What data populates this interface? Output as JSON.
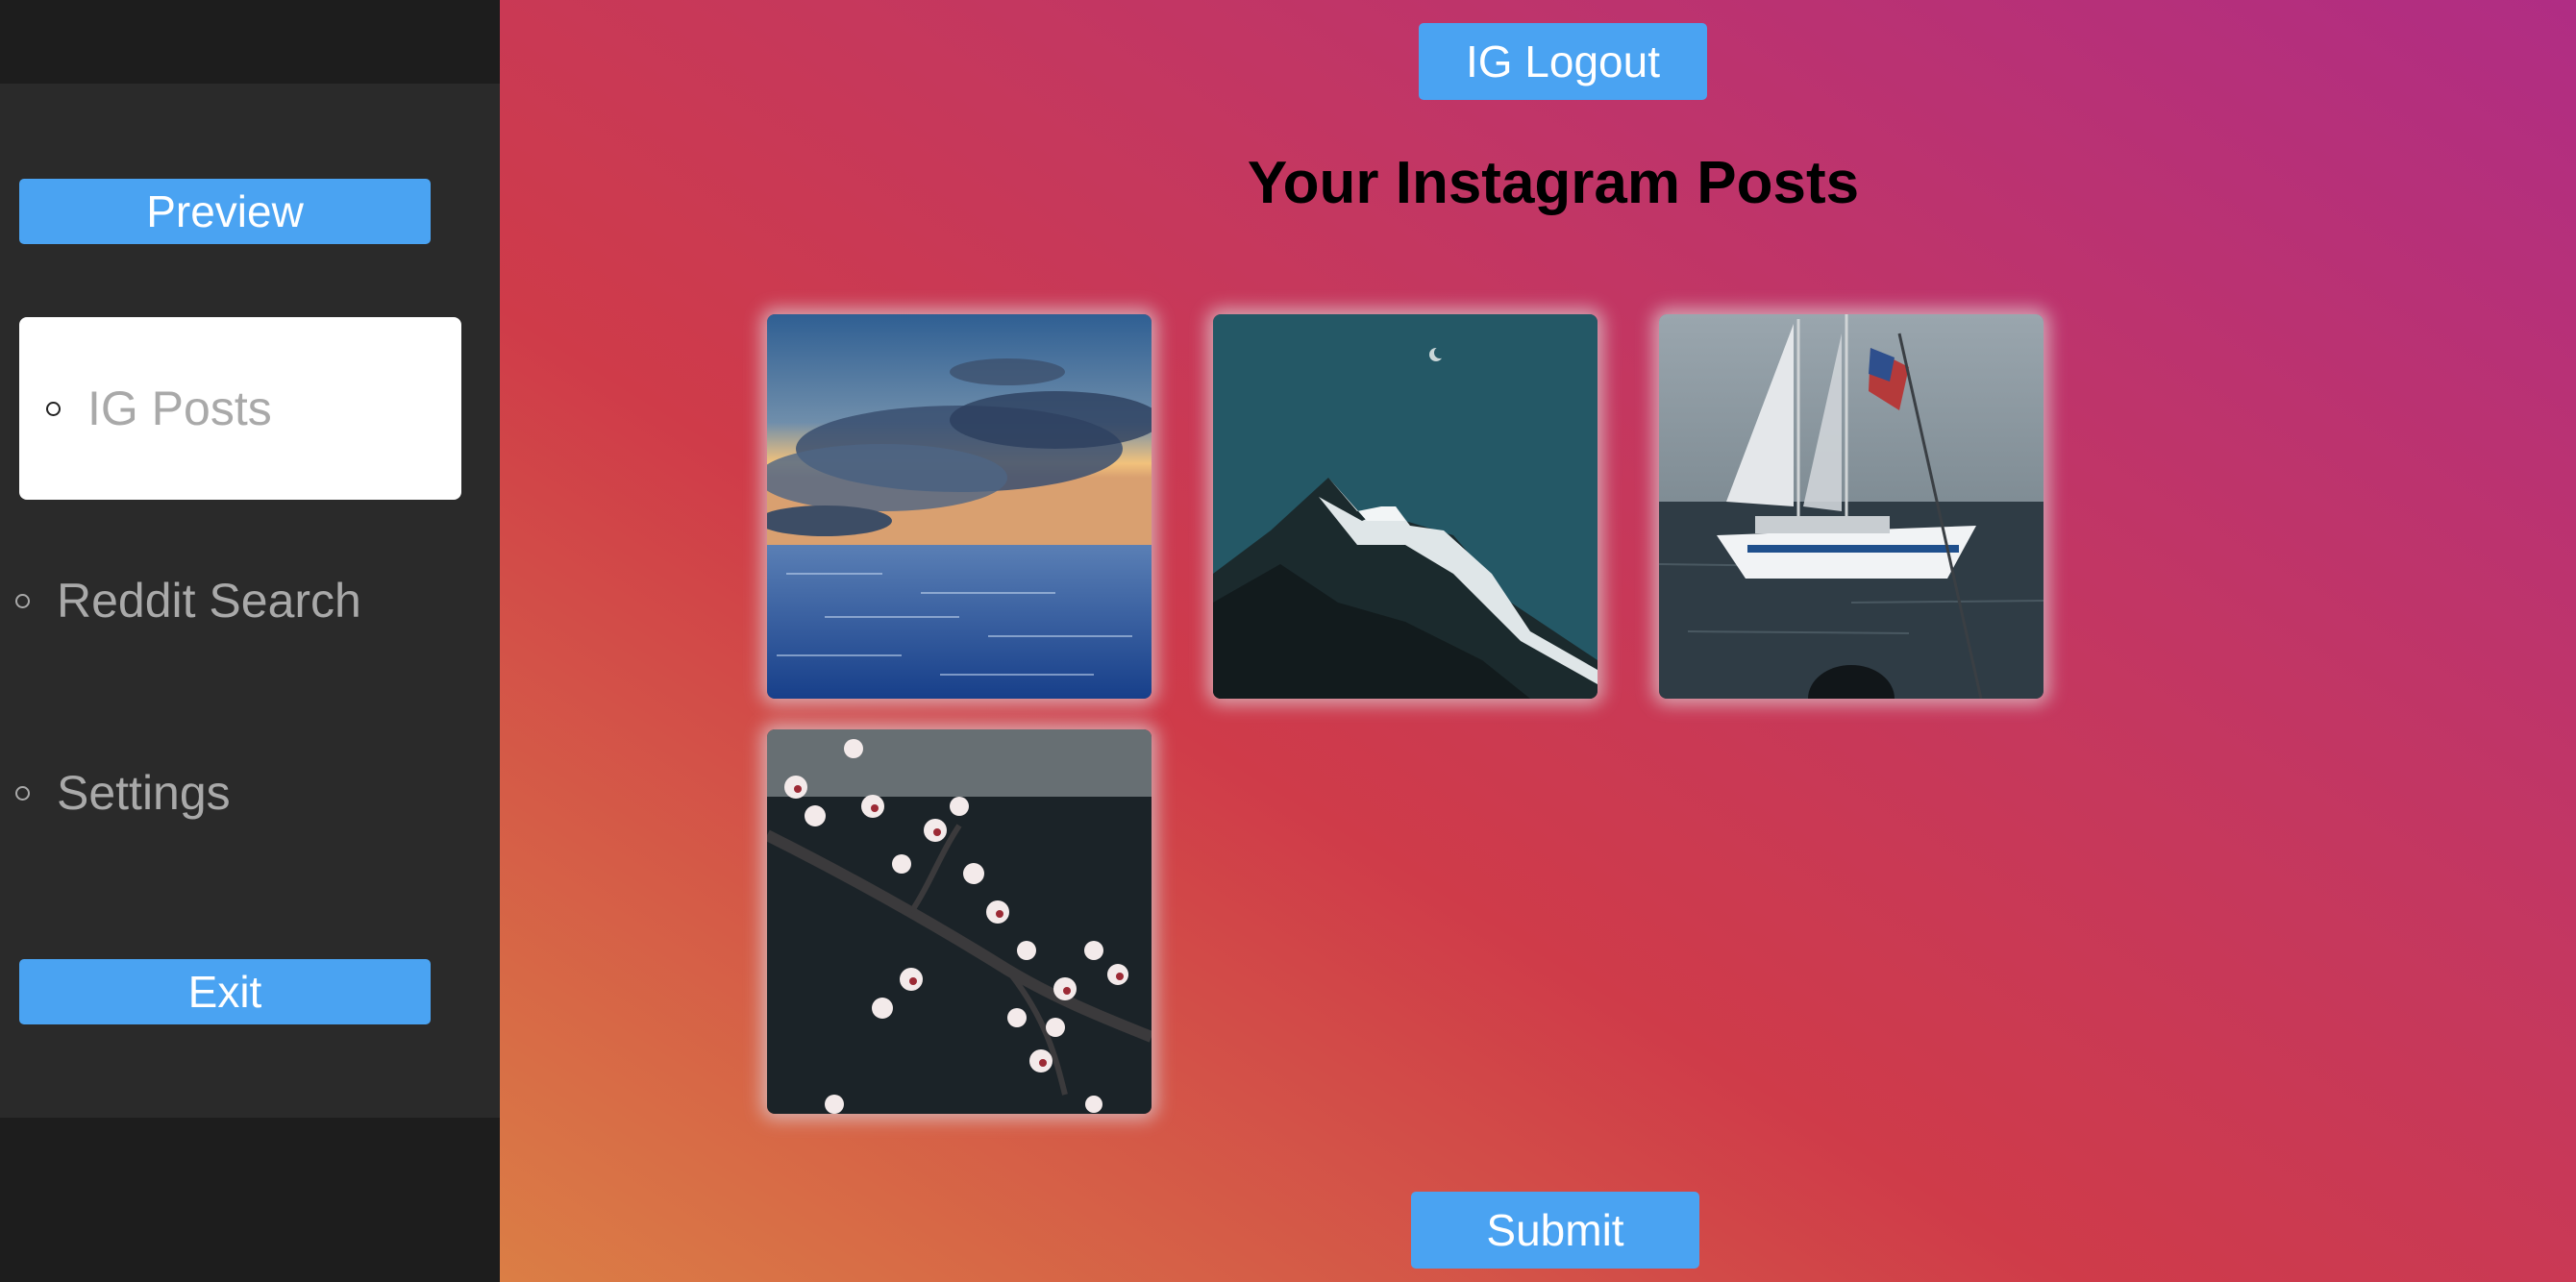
{
  "sidebar": {
    "preview_label": "Preview",
    "exit_label": "Exit",
    "nav": [
      {
        "label": "IG Posts",
        "active": true
      },
      {
        "label": "Reddit Search",
        "active": false
      },
      {
        "label": "Settings",
        "active": false
      }
    ]
  },
  "header": {
    "logout_label": "IG Logout"
  },
  "main": {
    "title": "Your Instagram Posts",
    "posts": [
      {
        "image": "ocean-sunset-clouds-photo"
      },
      {
        "image": "snowy-mountain-peak-moon-photo"
      },
      {
        "image": "sailboat-on-sea-photo"
      },
      {
        "image": "cherry-blossom-branch-photo"
      }
    ],
    "submit_label": "Submit"
  },
  "colors": {
    "button_blue": "#4aa3f2",
    "sidebar_dark": "#1d1d1d",
    "sidebar_panel": "#2a2a2a",
    "gradient_orange": "#db7e45",
    "gradient_red": "#cf3b49",
    "gradient_magenta": "#b02d84"
  }
}
